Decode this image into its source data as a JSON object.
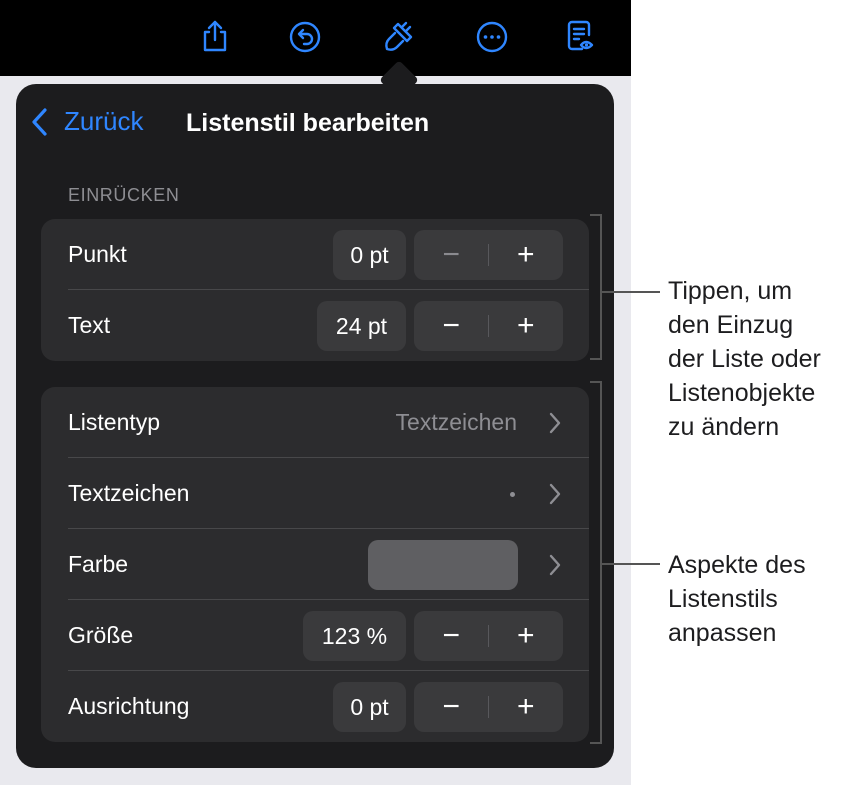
{
  "toolbar": {
    "icons": [
      "share-icon",
      "undo-icon",
      "format-brush-icon",
      "more-icon",
      "reader-view-icon"
    ],
    "accent": "#2f86ff"
  },
  "popover": {
    "back_label": "Zurück",
    "title": "Listenstil bearbeiten",
    "section_indent": "EINRÜCKEN",
    "indent_rows": [
      {
        "label": "Punkt",
        "value": "0 pt",
        "minus": "−",
        "plus": "+"
      },
      {
        "label": "Text",
        "value": "24 pt",
        "minus": "−",
        "plus": "+"
      }
    ],
    "style_rows": {
      "list_type": {
        "label": "Listentyp",
        "value": "Textzeichen"
      },
      "bullet": {
        "label": "Textzeichen",
        "value": "•"
      },
      "color": {
        "label": "Farbe",
        "swatch": "#5f5f62"
      },
      "size": {
        "label": "Größe",
        "value": "123 %",
        "minus": "−",
        "plus": "+"
      },
      "alignment": {
        "label": "Ausrichtung",
        "value": "0 pt",
        "minus": "−",
        "plus": "+"
      }
    }
  },
  "callouts": {
    "indent": "Tippen, um\nden Einzug\nder Liste oder\nListenobjekte\nzu ändern",
    "style": "Aspekte des\nListenstils\nanpassen"
  }
}
